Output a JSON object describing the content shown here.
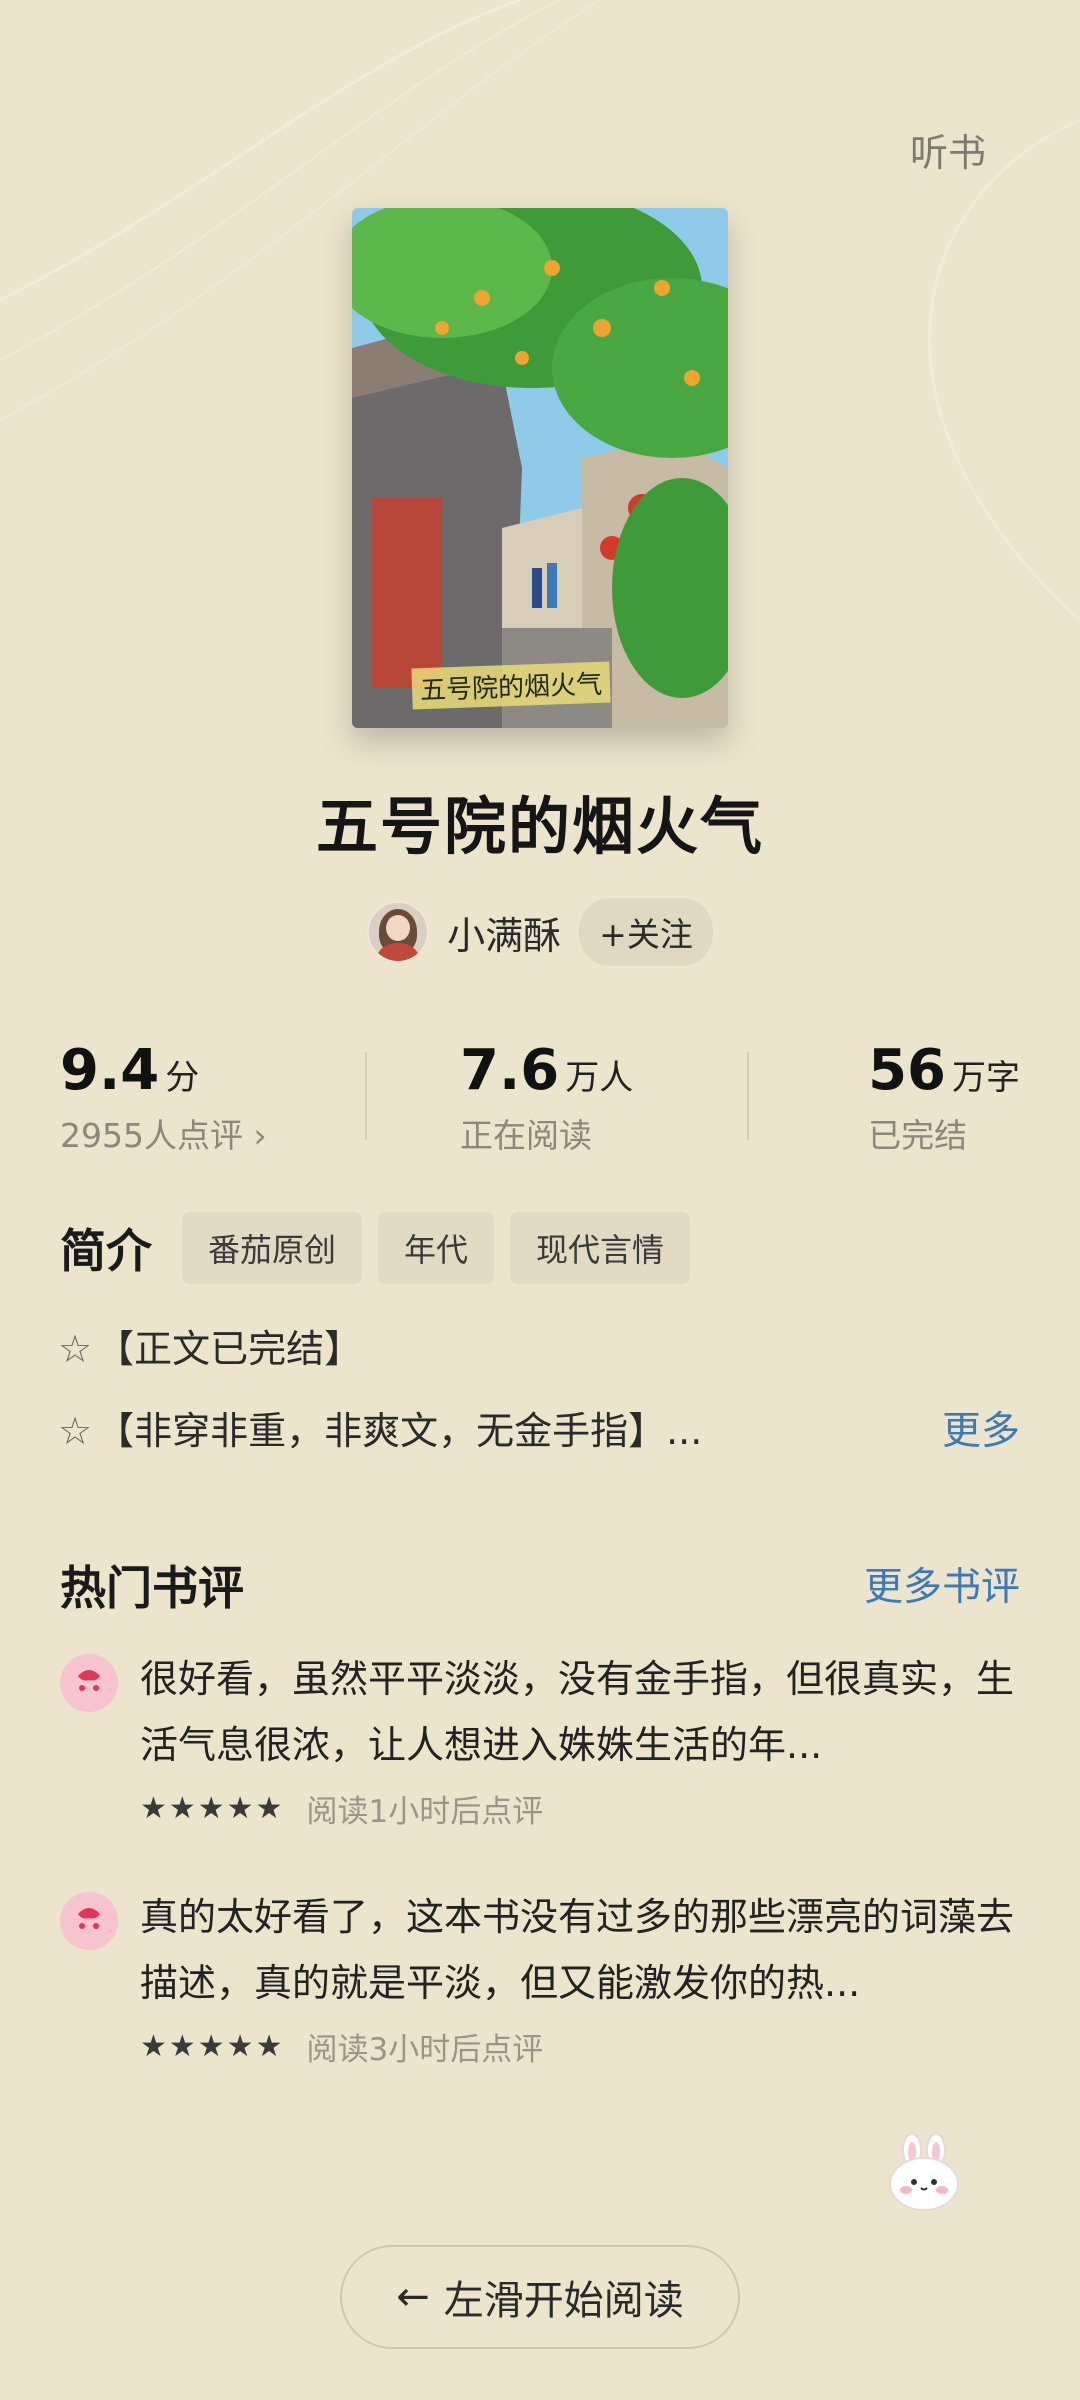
{
  "header": {
    "listen_label": "听书"
  },
  "book": {
    "cover_text": "五号院的烟火气",
    "title": "五号院的烟火气"
  },
  "author": {
    "name": "小满酥",
    "follow_label": "+关注"
  },
  "stats": {
    "rating_value": "9.4",
    "rating_unit": "分",
    "rating_sub": "2955人点评 ›",
    "readers_value": "7.6",
    "readers_unit": "万人",
    "readers_sub": "正在阅读",
    "words_value": "56",
    "words_unit": "万字",
    "words_sub": "已完结"
  },
  "intro": {
    "heading": "简介",
    "tags": [
      "番茄原创",
      "年代",
      "现代言情"
    ],
    "line1": "【正文已完结】",
    "line2": "【非穿非重，非爽文，无金手指】...",
    "star_glyph": "☆",
    "more_label": "更多"
  },
  "hot_reviews": {
    "heading": "热门书评",
    "more_label": "更多书评",
    "items": [
      {
        "text": "很好看，虽然平平淡淡，没有金手指，但很真实，生活气息很浓，让人想进入姝姝生活的年...",
        "stars": "★★★★★",
        "meta": "阅读1小时后点评"
      },
      {
        "text": "真的太好看了，这本书没有过多的那些漂亮的词藻去描述，真的就是平淡，但又能激发你的热...",
        "stars": "★★★★★",
        "meta": "阅读3小时后点评"
      }
    ]
  },
  "start_button": {
    "arrow": "←",
    "label": "左滑开始阅读"
  },
  "colors": {
    "background": "#ece4cd",
    "accent_link": "#3b79b8"
  }
}
